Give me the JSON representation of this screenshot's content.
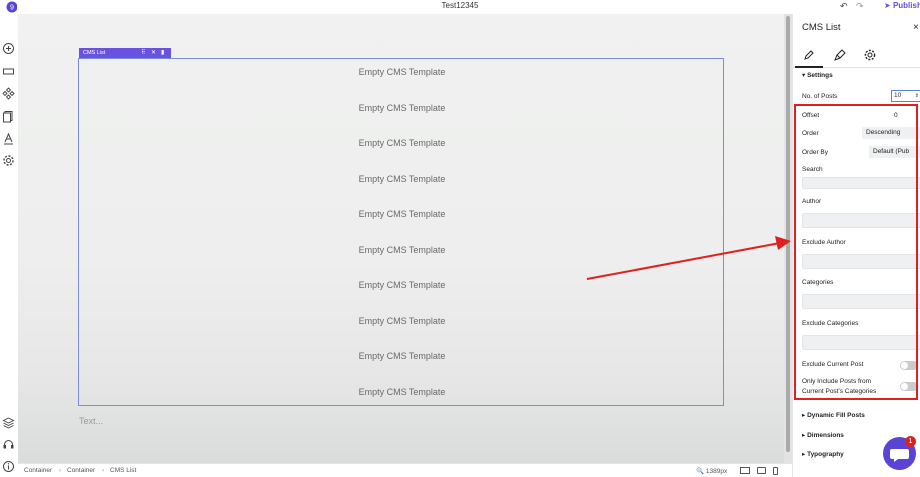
{
  "app": {
    "title": "Test12345",
    "publish_label": "Publish",
    "logo_badge": "9"
  },
  "canvas": {
    "element_label": "CMS List",
    "rows": [
      "Empty CMS Template",
      "Empty CMS Template",
      "Empty CMS Template",
      "Empty CMS Template",
      "Empty CMS Template",
      "Empty CMS Template",
      "Empty CMS Template",
      "Empty CMS Template",
      "Empty CMS Template",
      "Empty CMS Template"
    ],
    "text_placeholder": "Text..."
  },
  "bottombar": {
    "breadcrumb": [
      "Container",
      "Container",
      "CMS List"
    ],
    "zoom": "1389px"
  },
  "panel": {
    "title": "CMS List",
    "close": "×",
    "settings_header": "Settings",
    "fields": {
      "no_of_posts_label": "No. of Posts",
      "no_of_posts_value": "10",
      "offset_label": "Offset",
      "offset_value": "0",
      "order_label": "Order",
      "order_value": "Descending",
      "order_by_label": "Order By",
      "order_by_value": "Default (Pub",
      "search_label": "Search",
      "author_label": "Author",
      "exclude_author_label": "Exclude Author",
      "categories_label": "Categories",
      "exclude_categories_label": "Exclude Categories",
      "exclude_current_post_label": "Exclude Current Post",
      "only_include_line1": "Only Include Posts from",
      "only_include_line2": "Current Post's Categories"
    },
    "sections": [
      "Dynamic Fill Posts",
      "Dimensions",
      "Typography"
    ]
  },
  "chat": {
    "badge": "1"
  },
  "colors": {
    "accent": "#6a52e0",
    "annotation_red": "#e02020",
    "selection_border": "#7b8fd8"
  }
}
